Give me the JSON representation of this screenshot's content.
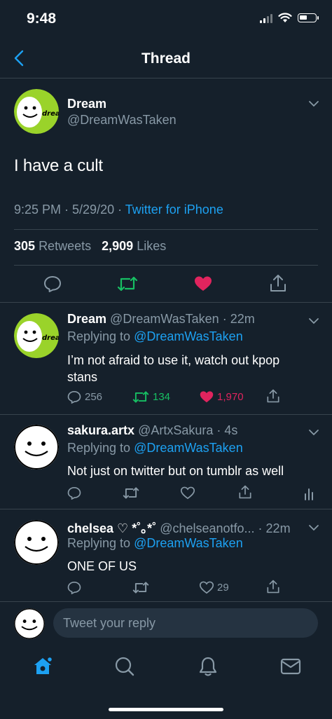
{
  "status_bar": {
    "time": "9:48"
  },
  "header": {
    "title": "Thread"
  },
  "main_tweet": {
    "avatar_text": "dream",
    "name": "Dream",
    "handle": "@DreamWasTaken",
    "text": "I have a cult",
    "time": "9:25 PM · 5/29/20 · ",
    "source": "Twitter for iPhone",
    "retweets_count": "305",
    "retweets_label": "Retweets",
    "likes_count": "2,909",
    "likes_label": "Likes",
    "liked": true
  },
  "replies": [
    {
      "name": "Dream",
      "handle_time": "@DreamWasTaken · 22m",
      "replying_prefix": "Replying to ",
      "replying_to": "@DreamWasTaken",
      "text": "I’m not afraid to use it, watch out kpop stans",
      "reply_count": "256",
      "retweet_count": "134",
      "like_count": "1,970",
      "retweeted": true,
      "liked": true
    },
    {
      "name": "sakura.artx",
      "handle_time": "@ArtxSakura · 4s",
      "replying_prefix": "Replying to ",
      "replying_to": "@DreamWasTaken",
      "text": "Not just on twitter but on tumblr as well",
      "reply_count": "",
      "retweet_count": "",
      "like_count": "",
      "retweeted": false,
      "liked": false
    },
    {
      "name": "chelsea ♡ *˚｡*˚",
      "handle_time": "@chelseanotfo... · 22m",
      "replying_prefix": "Replying to ",
      "replying_to": "@DreamWasTaken",
      "text": "ONE OF US",
      "reply_count": "",
      "retweet_count": "",
      "like_count": "29",
      "retweeted": false,
      "liked": false
    }
  ],
  "compose": {
    "placeholder": "Tweet your reply"
  },
  "colors": {
    "background": "#15202b",
    "accent": "#1da1f2",
    "retweet": "#17bf63",
    "like": "#e0245e",
    "muted": "#8899a6",
    "dream_green": "#9ad32a"
  },
  "icons": {
    "tab_bar": [
      "home-icon",
      "search-icon",
      "notifications-icon",
      "messages-icon"
    ]
  }
}
